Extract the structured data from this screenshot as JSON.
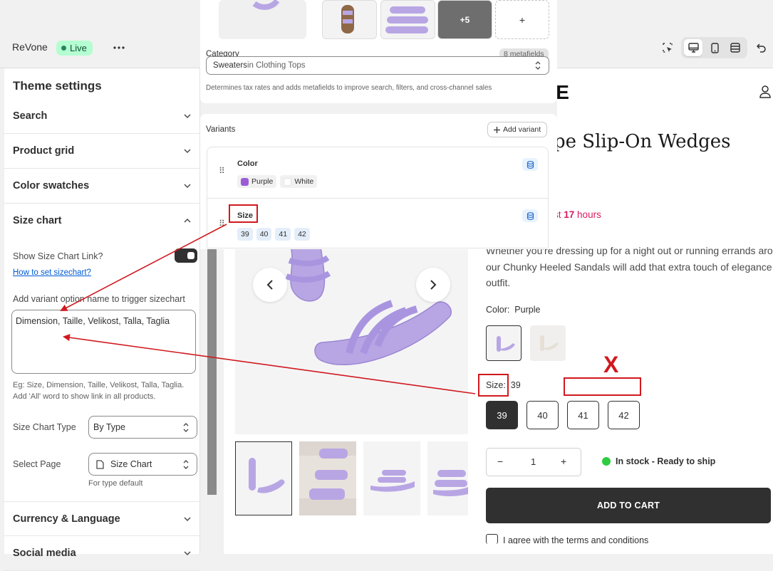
{
  "topbar": {
    "store_name": "ReVone",
    "status": "Live",
    "more": "•••"
  },
  "sidebar": {
    "title": "Theme settings",
    "sections": {
      "search": "Search",
      "product_grid": "Product grid",
      "color_swatches": "Color swatches",
      "size_chart": "Size chart",
      "currency": "Currency & Language",
      "social": "Social media"
    },
    "size_chart": {
      "show_link_label": "Show Size Chart Link?",
      "show_link_on": true,
      "help_link": "How to set sizechart?",
      "trigger_label": "Add variant option name to trigger sizechart",
      "trigger_value": "Dimension, Taille, Velikost, Talla, Taglia",
      "hint_line1": "Eg: Size, Dimension, Taille, Velikost, Talla, Taglia.",
      "hint_line2": "Add 'All' word to show link in all products.",
      "type_label": "Size Chart Type",
      "type_value": "By Type",
      "page_label": "Select Page",
      "page_value": "Size Chart",
      "page_note": "For type default"
    }
  },
  "admin": {
    "media_more": "+5",
    "media_add": "+",
    "category_label": "Category",
    "metafields_badge": "8 metafields",
    "category_main": "Sweaters",
    "category_in": " in Clothing Tops",
    "category_help": "Determines tax rates and adds metafields to improve search, filters, and cross-channel sales",
    "variants_label": "Variants",
    "add_variant": "Add variant",
    "option_color": "Color",
    "color_values": [
      "Purple",
      "White"
    ],
    "option_size": "Size",
    "size_values": [
      "39",
      "40",
      "41",
      "42"
    ]
  },
  "store": {
    "logo_partial": "NE",
    "title_partial": "pe Slip-On Wedges",
    "urgency_prefix": "st ",
    "urgency_hours": "17",
    "urgency_suffix": " hours",
    "desc_line1": "Whether you're dressing up for a night out or running errands arou",
    "desc_line2": "our Chunky Heeled Sandals will add that extra touch of elegance t",
    "desc_line3": "outfit.",
    "color_label": "Color:",
    "color_value": "Purple",
    "size_label": "Size:",
    "size_value": "39",
    "sizes": [
      "39",
      "40",
      "41",
      "42"
    ],
    "qty": "1",
    "qty_minus": "−",
    "qty_plus": "+",
    "stock": "In stock - Ready to ship",
    "add_to_cart": "ADD TO CART",
    "terms_partial": "I agree with the terms and conditions",
    "terms_visible_a": "",
    "terms_visible_b": "",
    "terms_bold_tail": "nd",
    "terms_tail2": "itions"
  },
  "annotation": {
    "x_mark": "X"
  },
  "colors": {
    "purple": "#9c5bd6",
    "accent_red": "#d0191e",
    "urgency": "#d81b60",
    "stock_green": "#2ecc40"
  }
}
